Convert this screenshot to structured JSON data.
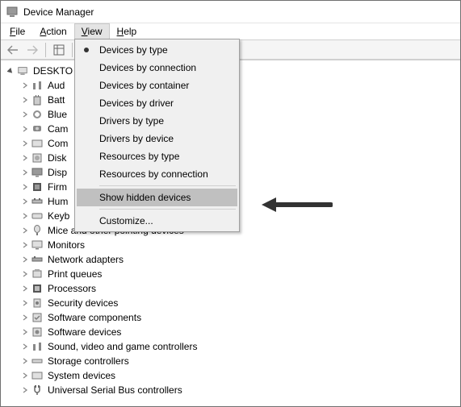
{
  "title": "Device Manager",
  "menubar": {
    "file": "File",
    "action": "Action",
    "view": "View",
    "help": "Help"
  },
  "dropdown": {
    "items": [
      "Devices by type",
      "Devices by connection",
      "Devices by container",
      "Devices by driver",
      "Drivers by type",
      "Drivers by device",
      "Resources by type",
      "Resources by connection"
    ],
    "show_hidden": "Show hidden devices",
    "customize": "Customize..."
  },
  "tree": {
    "root": "DESKTO",
    "items": [
      "Aud",
      "Batt",
      "Blue",
      "Cam",
      "Com",
      "Disk",
      "Disp",
      "Firm",
      "Hum",
      "Keyb",
      "Mice and other pointing devices",
      "Monitors",
      "Network adapters",
      "Print queues",
      "Processors",
      "Security devices",
      "Software components",
      "Software devices",
      "Sound, video and game controllers",
      "Storage controllers",
      "System devices",
      "Universal Serial Bus controllers"
    ]
  }
}
